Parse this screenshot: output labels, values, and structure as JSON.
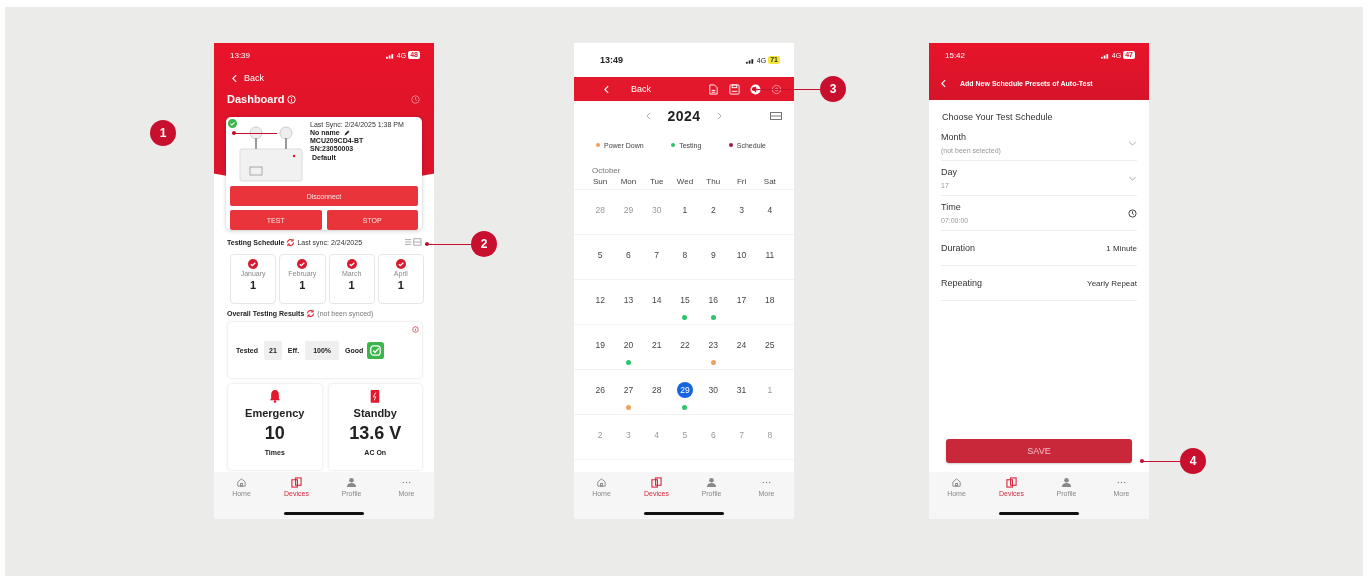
{
  "callouts": [
    {
      "number": "1"
    },
    {
      "number": "2"
    },
    {
      "number": "3"
    },
    {
      "number": "4"
    }
  ],
  "dashboard": {
    "status_bar": {
      "time": "13:39",
      "network": "4G",
      "battery": "48"
    },
    "back": "Back",
    "title": "Dashboard",
    "device": {
      "connected": true,
      "last_sync": "Last Sync: 2/24/2025 1:38 PM",
      "name": "No name",
      "model": "MCU209CD4-BT",
      "serial": "SN:23050003",
      "profile": "Default"
    },
    "buttons": {
      "disconnect": "Disconnect",
      "test": "TEST",
      "stop": "STOP"
    },
    "testing_schedule": {
      "title": "Testing Schedule",
      "last_sync": "Last sync: 2/24/2025",
      "months": [
        {
          "label": "January",
          "count": "1"
        },
        {
          "label": "February",
          "count": "1"
        },
        {
          "label": "March",
          "count": "1"
        },
        {
          "label": "April",
          "count": "1"
        }
      ]
    },
    "overall": {
      "title": "Overall Testing Results",
      "note": "(not been synced)",
      "tested_label": "Tested",
      "tested": "21",
      "eff_label": "Eff.",
      "eff": "100%",
      "status": "Good"
    },
    "stats": [
      {
        "kind": "emergency",
        "title": "Emergency",
        "value": "10",
        "unit": "Times"
      },
      {
        "kind": "standby",
        "title": "Standby",
        "value": "13.6 V",
        "unit": "AC On"
      }
    ],
    "tab_bar": [
      {
        "label": "Home",
        "selected": false
      },
      {
        "label": "Devices",
        "selected": true
      },
      {
        "label": "Profile",
        "selected": false
      },
      {
        "label": "More",
        "selected": false
      }
    ]
  },
  "calendar": {
    "status_bar": {
      "time": "13:49",
      "network": "4G",
      "battery": "71"
    },
    "back": "Back",
    "year": "2024",
    "legend": [
      {
        "label": "Power Down",
        "color": "#f0a05a"
      },
      {
        "label": "Testing",
        "color": "#2ec36b"
      },
      {
        "label": "Schedule",
        "color": "#a3183a"
      }
    ],
    "month": "October",
    "weekdays": [
      "Sun",
      "Mon",
      "Tue",
      "Wed",
      "Thu",
      "Fri",
      "Sat"
    ],
    "days": [
      {
        "label": "28",
        "in_month": false,
        "selected": false
      },
      {
        "label": "29",
        "in_month": false,
        "selected": false
      },
      {
        "label": "30",
        "in_month": false,
        "selected": false
      },
      {
        "label": "1",
        "in_month": true,
        "selected": false
      },
      {
        "label": "2",
        "in_month": true,
        "selected": false
      },
      {
        "label": "3",
        "in_month": true,
        "selected": false
      },
      {
        "label": "4",
        "in_month": true,
        "selected": false
      },
      {
        "label": "5",
        "in_month": true,
        "selected": false
      },
      {
        "label": "6",
        "in_month": true,
        "selected": false
      },
      {
        "label": "7",
        "in_month": true,
        "selected": false
      },
      {
        "label": "8",
        "in_month": true,
        "selected": false
      },
      {
        "label": "9",
        "in_month": true,
        "selected": false
      },
      {
        "label": "10",
        "in_month": true,
        "selected": false
      },
      {
        "label": "11",
        "in_month": true,
        "selected": false
      },
      {
        "label": "12",
        "in_month": true,
        "selected": false
      },
      {
        "label": "13",
        "in_month": true,
        "selected": false
      },
      {
        "label": "14",
        "in_month": true,
        "selected": false
      },
      {
        "label": "15",
        "in_month": true,
        "selected": false,
        "color": "#2ec36b"
      },
      {
        "label": "16",
        "in_month": true,
        "selected": false,
        "color": "#2ec36b"
      },
      {
        "label": "17",
        "in_month": true,
        "selected": false
      },
      {
        "label": "18",
        "in_month": true,
        "selected": false
      },
      {
        "label": "19",
        "in_month": true,
        "selected": false
      },
      {
        "label": "20",
        "in_month": true,
        "selected": false,
        "color": "#2ec36b"
      },
      {
        "label": "21",
        "in_month": true,
        "selected": false
      },
      {
        "label": "22",
        "in_month": true,
        "selected": false
      },
      {
        "label": "23",
        "in_month": true,
        "selected": false,
        "color": "#f0a05a"
      },
      {
        "label": "24",
        "in_month": true,
        "selected": false
      },
      {
        "label": "25",
        "in_month": true,
        "selected": false
      },
      {
        "label": "26",
        "in_month": true,
        "selected": false
      },
      {
        "label": "27",
        "in_month": true,
        "selected": false,
        "color": "#f0a05a"
      },
      {
        "label": "28",
        "in_month": true,
        "selected": false
      },
      {
        "label": "29",
        "in_month": true,
        "selected": true,
        "color": "#2ec36b"
      },
      {
        "label": "30",
        "in_month": true,
        "selected": false
      },
      {
        "label": "31",
        "in_month": true,
        "selected": false
      },
      {
        "label": "1",
        "in_month": false,
        "selected": false
      },
      {
        "label": "2",
        "in_month": false,
        "selected": false
      },
      {
        "label": "3",
        "in_month": false,
        "selected": false
      },
      {
        "label": "4",
        "in_month": false,
        "selected": false
      },
      {
        "label": "5",
        "in_month": false,
        "selected": false
      },
      {
        "label": "6",
        "in_month": false,
        "selected": false
      },
      {
        "label": "7",
        "in_month": false,
        "selected": false
      },
      {
        "label": "8",
        "in_month": false,
        "selected": false
      }
    ],
    "tab_bar": [
      {
        "label": "Home",
        "selected": false
      },
      {
        "label": "Devices",
        "selected": true
      },
      {
        "label": "Profile",
        "selected": false
      },
      {
        "label": "More",
        "selected": false
      }
    ]
  },
  "schedule_form": {
    "status_bar": {
      "time": "15:42",
      "network": "4G",
      "battery": "47"
    },
    "title": "Add New Schedule Presets of Auto-Test",
    "heading": "Choose Your Test Schedule",
    "fields": [
      {
        "kind": "select",
        "label": "Month",
        "placeholder": "(not been selected)"
      },
      {
        "kind": "select",
        "label": "Day",
        "placeholder": "17"
      },
      {
        "kind": "time",
        "label": "Time",
        "placeholder": "07:00:00"
      },
      {
        "kind": "inline",
        "label": "Duration",
        "value": "1 Minute"
      },
      {
        "kind": "inline",
        "label": "Repeating",
        "value": "Yearly Repeat"
      }
    ],
    "save": "SAVE",
    "tab_bar": [
      {
        "label": "Home",
        "selected": false
      },
      {
        "label": "Devices",
        "selected": true
      },
      {
        "label": "Profile",
        "selected": false
      },
      {
        "label": "More",
        "selected": false
      }
    ]
  }
}
